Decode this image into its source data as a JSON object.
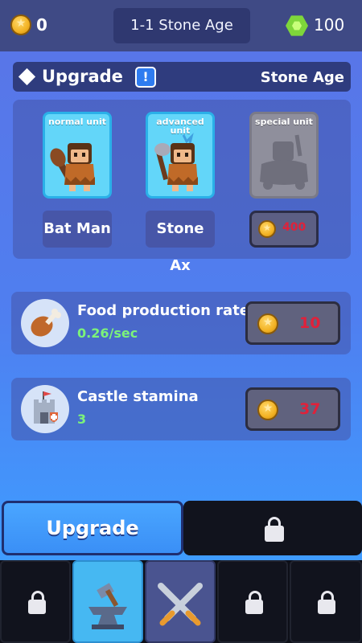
{
  "topbar": {
    "gold": "0",
    "stage": "1-1 Stone Age",
    "gems": "100"
  },
  "upgrade_section": {
    "title": "Upgrade",
    "info_badge": "!",
    "age": "Stone Age"
  },
  "units": [
    {
      "card_title": "normal unit",
      "name": "Bat Man"
    },
    {
      "card_title": "advanced unit",
      "name": "Stone Ax"
    },
    {
      "card_title": "special unit",
      "price": "400"
    }
  ],
  "rows": [
    {
      "title": "Food production rate",
      "value": "0.26/sec",
      "price": "10",
      "icon": "drumstick-icon"
    },
    {
      "title": "Castle stamina",
      "value": "3",
      "price": "37",
      "icon": "castle-icon"
    }
  ],
  "tabs": {
    "upgrade_label": "Upgrade"
  },
  "nav": [
    "locked",
    "upgrade-forge",
    "battle",
    "locked",
    "locked"
  ],
  "colors": {
    "accent_blue": "#3f9bff",
    "price_red": "#e0213a",
    "value_green": "#7cf27a"
  }
}
